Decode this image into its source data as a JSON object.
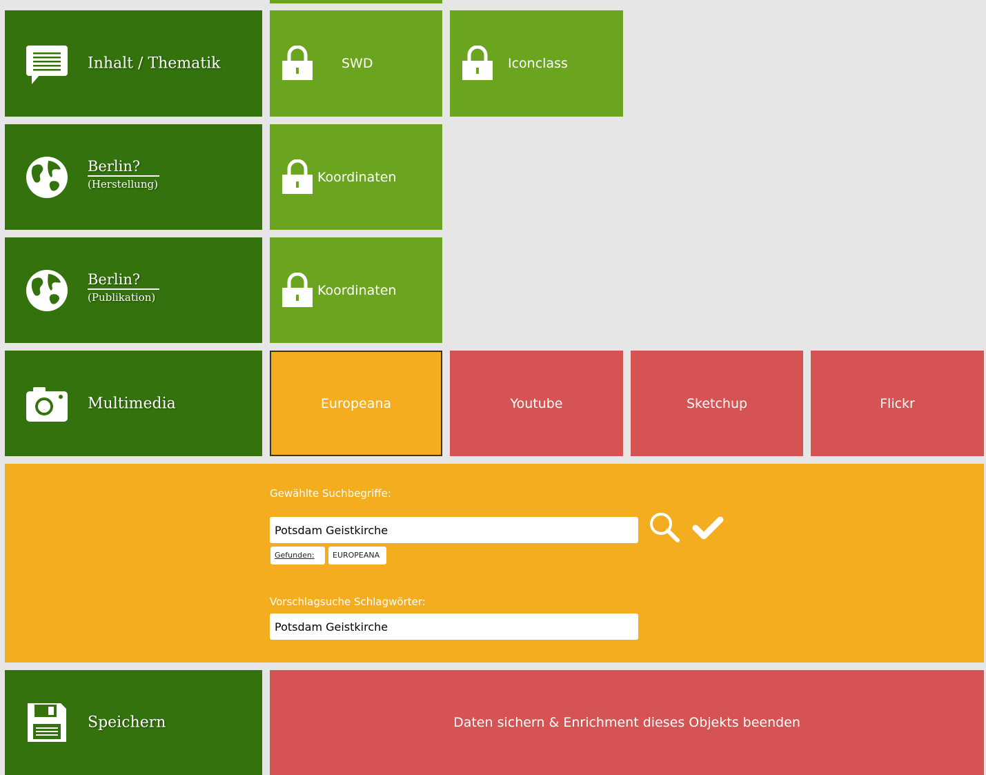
{
  "rows": {
    "inhalt": {
      "category": "Inhalt / Thematik",
      "icon": "chat-bubble-icon",
      "options": [
        "SWD",
        "Iconclass"
      ]
    },
    "herstellung": {
      "category": "Berlin?",
      "sub": "(Herstellung)",
      "icon": "globe-icon",
      "option": "Koordinaten"
    },
    "publikation": {
      "category": "Berlin?",
      "sub": "(Publikation)",
      "icon": "globe-icon",
      "option": "Koordinaten"
    },
    "multimedia": {
      "category": "Multimedia",
      "icon": "camera-icon",
      "sources": [
        "Europeana",
        "Youtube",
        "Sketchup",
        "Flickr"
      ],
      "selected": "Europeana"
    },
    "save": {
      "category": "Speichern",
      "icon": "floppy-disk-icon",
      "action": "Daten sichern & Enrichment dieses Objekts beenden"
    }
  },
  "search_panel": {
    "selected_label": "Gewählte Suchbegriffe:",
    "selected_value": "Potsdam Geistkirche",
    "found_label": "Gefunden:",
    "found_source": "EUROPEANA",
    "suggest_label": "Vorschlagsuche Schlagwörter:",
    "suggest_value": "Potsdam Geistkirche"
  },
  "colors": {
    "category": "#33720c",
    "option": "#6ba51f",
    "selected": "#f4ad1e",
    "source": "#d55353",
    "background": "#e6e6e6"
  }
}
